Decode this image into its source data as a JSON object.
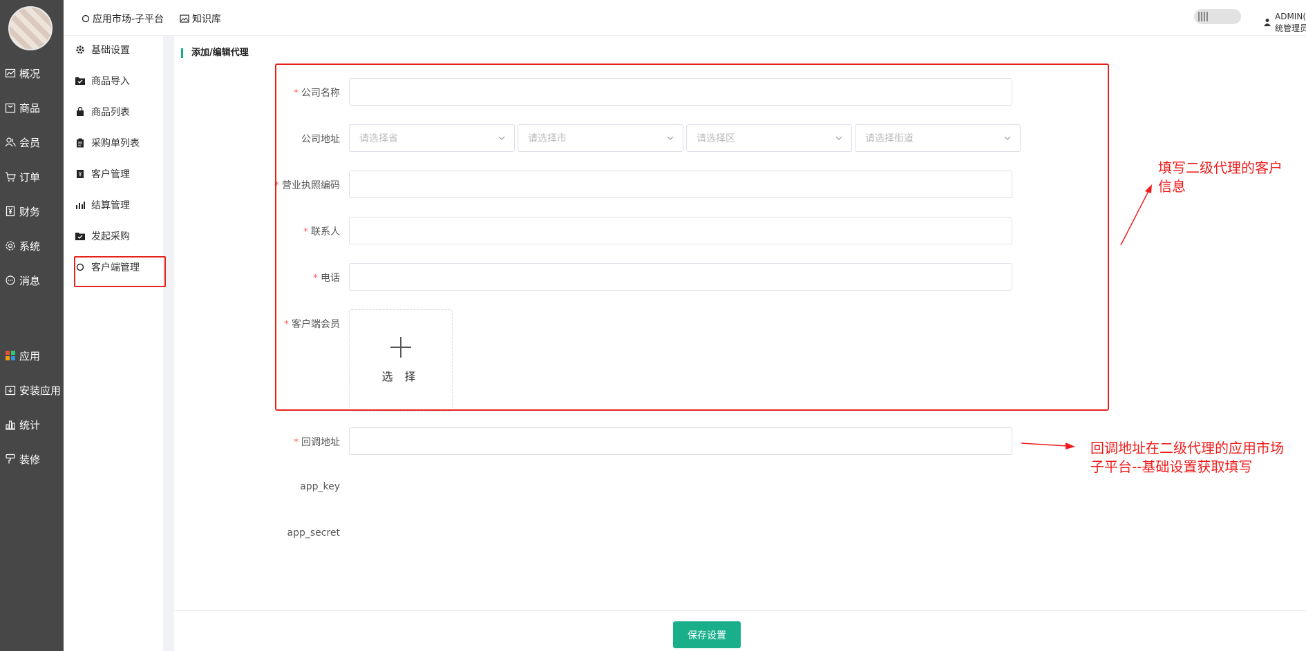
{
  "rail": {
    "items": [
      {
        "label": "概况",
        "icon": "chart-line-icon"
      },
      {
        "label": "商品",
        "icon": "bag-icon"
      },
      {
        "label": "会员",
        "icon": "users-icon"
      },
      {
        "label": "订单",
        "icon": "cart-icon"
      },
      {
        "label": "财务",
        "icon": "yen-icon"
      },
      {
        "label": "系统",
        "icon": "gear-icon"
      },
      {
        "label": "消息",
        "icon": "message-icon"
      },
      {
        "label": "应用",
        "icon": "apps-grid-icon"
      },
      {
        "label": "安装应用",
        "icon": "install-icon"
      },
      {
        "label": "统计",
        "icon": "bar-chart-icon"
      },
      {
        "label": "装修",
        "icon": "brush-icon"
      }
    ]
  },
  "header": {
    "links": [
      {
        "label": "应用市场-子平台",
        "icon": "circle-icon"
      },
      {
        "label": "知识库",
        "icon": "image-icon"
      }
    ],
    "user_label": "ADMIN(系统管理员)"
  },
  "subnav": {
    "items": [
      {
        "label": "基础设置",
        "icon": "gear-icon"
      },
      {
        "label": "商品导入",
        "icon": "folder-check-icon"
      },
      {
        "label": "商品列表",
        "icon": "bag-icon"
      },
      {
        "label": "采购单列表",
        "icon": "clipboard-icon"
      },
      {
        "label": "客户管理",
        "icon": "book-icon"
      },
      {
        "label": "结算管理",
        "icon": "bars-icon"
      },
      {
        "label": "发起采购",
        "icon": "folder-check-icon"
      },
      {
        "label": "客户端管理",
        "icon": "circle-icon"
      }
    ],
    "active_index": 7
  },
  "form": {
    "section_title": "添加/编辑代理",
    "company_name": {
      "label": "公司名称",
      "required": true,
      "value": ""
    },
    "company_address": {
      "label": "公司地址",
      "selects": [
        {
          "placeholder": "请选择省"
        },
        {
          "placeholder": "请选择市"
        },
        {
          "placeholder": "请选择区"
        },
        {
          "placeholder": "请选择街道"
        }
      ]
    },
    "license_code": {
      "label": "营业执照编码",
      "required": true,
      "value": ""
    },
    "contact": {
      "label": "联系人",
      "required": true,
      "value": ""
    },
    "phone": {
      "label": "电话",
      "required": true,
      "value": ""
    },
    "client_member": {
      "label": "客户端会员",
      "required": true,
      "upload_label": "选 择"
    },
    "callback_url": {
      "label": "回调地址",
      "required": true,
      "value": ""
    },
    "app_key": {
      "label": "app_key",
      "value": ""
    },
    "app_secret": {
      "label": "app_secret",
      "value": ""
    },
    "save_label": "保存设置"
  },
  "annotations": {
    "fill_info": [
      "填写二级代理的客户",
      "信息"
    ],
    "callback_hint": [
      "回调地址在二级代理的应用市场",
      "子平台--基础设置获取填写"
    ],
    "color": "#f01c1c"
  },
  "colors": {
    "accent": "#1aaf8b",
    "sidebar": "#474747",
    "required": "#f56c6c"
  }
}
